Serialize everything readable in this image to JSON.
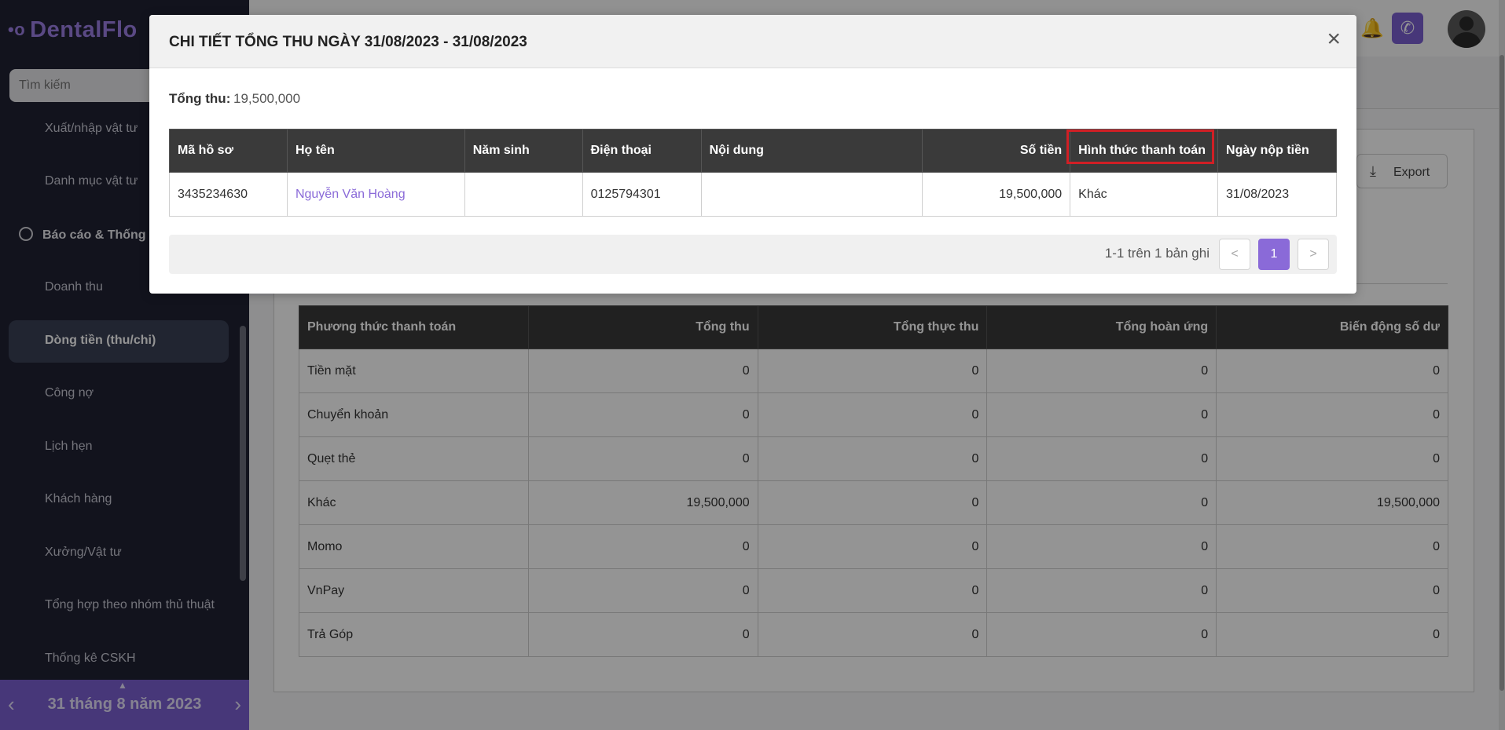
{
  "app": {
    "logo_text": "DentalFlo",
    "logo_dots": "•o"
  },
  "sidebar": {
    "search_placeholder": "Tìm kiếm",
    "items": [
      {
        "label": "Xuất/nhập vật tư"
      },
      {
        "label": "Danh mục vật tư"
      },
      {
        "label": "Báo cáo & Thống k"
      },
      {
        "label": "Doanh thu"
      },
      {
        "label": "Dòng tiền (thu/chi)"
      },
      {
        "label": "Công nợ"
      },
      {
        "label": "Lịch hẹn"
      },
      {
        "label": "Khách hàng"
      },
      {
        "label": "Xưởng/Vật tư"
      },
      {
        "label": "Tổng hợp theo nhóm thủ thuật"
      },
      {
        "label": "Thống kê CSKH"
      }
    ],
    "date_label": "31 tháng 8 năm 2023",
    "prev_icon": "‹",
    "next_icon": "›",
    "up_icon": "▲"
  },
  "header": {
    "bell_icon": "🔔",
    "phone_icon": "✆"
  },
  "panel": {
    "export_label": "Export",
    "export_icon": "⤓",
    "summary": {
      "columns": [
        "Phương thức thanh toán",
        "Tổng thu",
        "Tổng thực thu",
        "Tổng hoàn ứng",
        "Biến động số dư"
      ],
      "rows": [
        [
          "Tiền mặt",
          "0",
          "0",
          "0",
          "0"
        ],
        [
          "Chuyển khoản",
          "0",
          "0",
          "0",
          "0"
        ],
        [
          "Quẹt thẻ",
          "0",
          "0",
          "0",
          "0"
        ],
        [
          "Khác",
          "19,500,000",
          "0",
          "0",
          "19,500,000"
        ],
        [
          "Momo",
          "0",
          "0",
          "0",
          "0"
        ],
        [
          "VnPay",
          "0",
          "0",
          "0",
          "0"
        ],
        [
          "Trả Góp",
          "0",
          "0",
          "0",
          "0"
        ]
      ]
    }
  },
  "modal": {
    "title": "CHI TIẾT TỔNG THU NGÀY 31/08/2023 - 31/08/2023",
    "close_icon": "×",
    "total_label": "Tổng thu:",
    "total_value": "19,500,000",
    "columns": [
      "Mã hồ sơ",
      "Họ tên",
      "Năm sinh",
      "Điện thoại",
      "Nội dung",
      "Số tiền",
      "Hình thức thanh toán",
      "Ngày nộp tiền"
    ],
    "row": {
      "ma_ho_so": "3435234630",
      "ho_ten": "Nguyễn Văn Hoàng",
      "nam_sinh": "",
      "dien_thoai": "0125794301",
      "noi_dung": "",
      "so_tien": "19,500,000",
      "hinh_thuc": "Khác",
      "ngay_nop": "31/08/2023"
    },
    "pagination": {
      "info": "1-1 trên 1 bản ghi",
      "prev": "<",
      "current": "1",
      "next": ">"
    }
  }
}
